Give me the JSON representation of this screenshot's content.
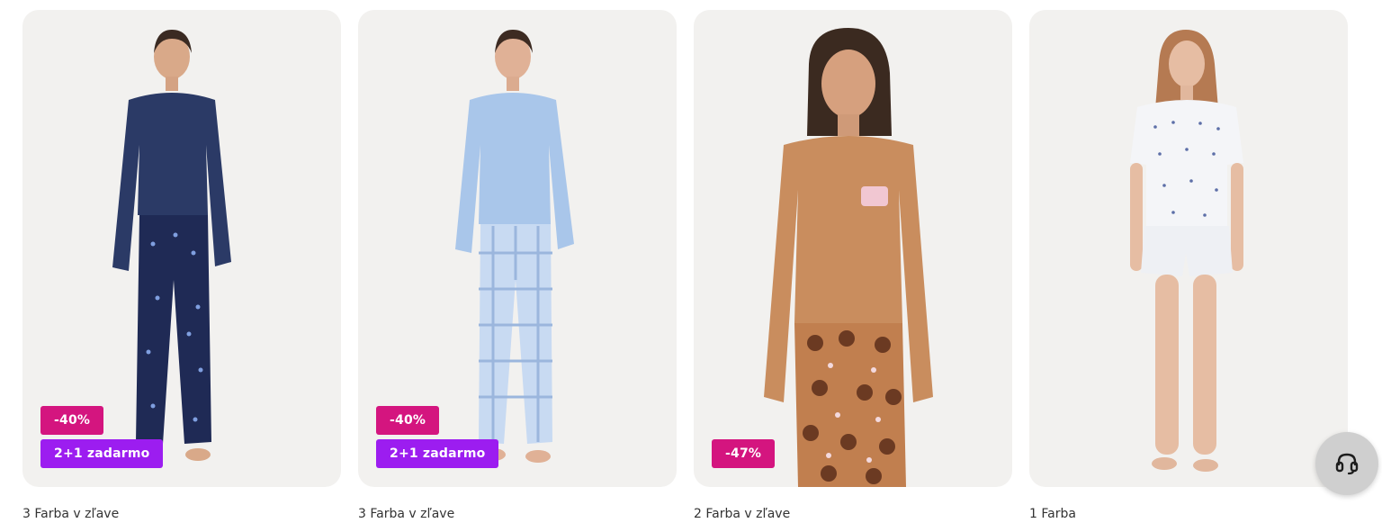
{
  "products": [
    {
      "badges": [
        {
          "kind": "discount",
          "text": "-40%"
        },
        {
          "kind": "promo",
          "text": "2+1 zadarmo"
        }
      ],
      "colors_text": "3 Farba v zľave",
      "top_color": "#2b3a66",
      "bottom_color": "#1f2a55",
      "pattern": "stars"
    },
    {
      "badges": [
        {
          "kind": "discount",
          "text": "-40%"
        },
        {
          "kind": "promo",
          "text": "2+1 zadarmo"
        }
      ],
      "colors_text": "3 Farba v zľave",
      "top_color": "#a9c6ea",
      "bottom_color": "#c8daf2",
      "pattern": "gingham"
    },
    {
      "badges": [
        {
          "kind": "discount",
          "text": "-47%"
        }
      ],
      "colors_text": "2 Farba v zľave",
      "top_color": "#c98d5e",
      "bottom_color": "#c17f4f",
      "pattern": "print"
    },
    {
      "badges": [],
      "colors_text": "1 Farba",
      "top_color": "#f4f5f8",
      "bottom_color": "#eef0f4",
      "pattern": "dots"
    }
  ],
  "support_button": {
    "icon": "headset-icon"
  },
  "colors": {
    "discount_badge": "#d4157f",
    "promo_badge": "#9c1df0",
    "card_bg": "#f2f1ef"
  }
}
